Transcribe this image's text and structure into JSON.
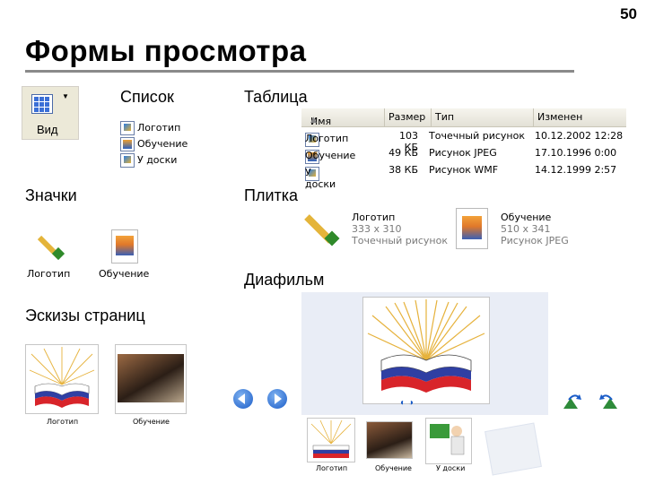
{
  "slide_number": "50",
  "title": "Формы просмотра",
  "view_button": {
    "label": "Вид"
  },
  "sections": {
    "list": "Список",
    "table": "Таблица",
    "icons": "Значки",
    "tiles": "Плитка",
    "filmstrip": "Диафильм",
    "thumbnails": "Эскизы страниц"
  },
  "files": [
    "Логотип",
    "Обучение",
    "У доски"
  ],
  "table": {
    "headers": [
      "Имя",
      "Размер",
      "Тип",
      "Изменен"
    ],
    "rows": [
      [
        "Логотип",
        "103 КБ",
        "Точечный рисунок",
        "10.12.2002 12:28"
      ],
      [
        "Обучение",
        "49 КБ",
        "Рисунок JPEG",
        "17.10.1996 0:00"
      ],
      [
        "У доски",
        "38 КБ",
        "Рисунок WMF",
        "14.12.1999 2:57"
      ]
    ]
  },
  "icons_view": [
    "Логотип",
    "Обучение"
  ],
  "tiles": [
    {
      "name": "Логотип",
      "dims": "333 x 310",
      "type": "Точечный рисунок"
    },
    {
      "name": "Обучение",
      "dims": "510 x 341",
      "type": "Рисунок JPEG"
    }
  ],
  "thumbnails": [
    "Логотип",
    "Обучение"
  ],
  "filmstrip": [
    "Логотип",
    "Обучение",
    "У доски"
  ],
  "colors": {
    "flag_blue": "#2f3fa3",
    "flag_red": "#d8242a",
    "nav_blue": "#1a5cc8",
    "rule": "#8a8a8a"
  }
}
